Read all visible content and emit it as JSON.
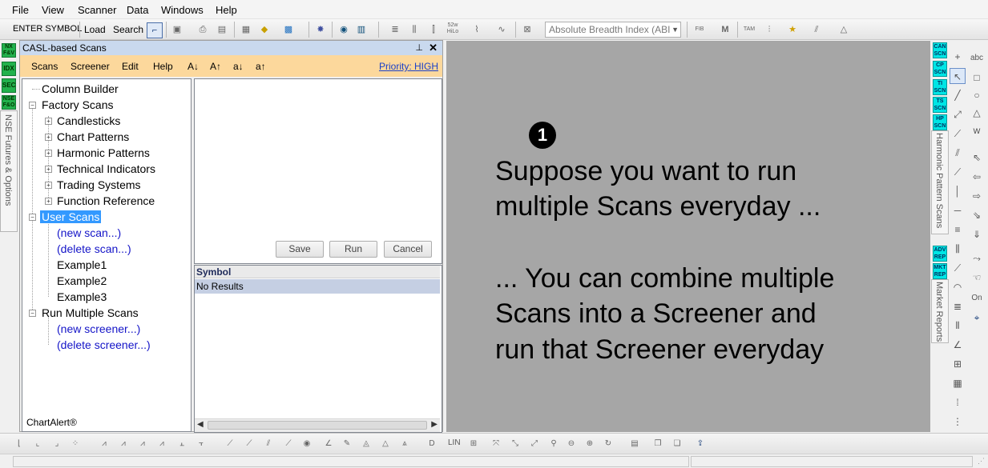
{
  "menu": [
    "File",
    "View",
    "Scanner",
    "Data",
    "Windows",
    "Help"
  ],
  "toolbar": {
    "enter_symbol": "ENTER SYMBOL",
    "load": "Load",
    "search": "Search",
    "icon_52w": "52w HiLo",
    "breadth_select_value": "Absolute Breadth Index (ABI"
  },
  "left_strip": {
    "buttons": [
      "NX F&V",
      "IDX",
      "SEC",
      "NSE F&O"
    ],
    "tab_label": "NSE Futures & Options"
  },
  "panel": {
    "title": "CASL-based Scans",
    "menu": [
      "Scans",
      "Screener",
      "Edit",
      "Help"
    ],
    "sort_buttons": [
      "A↓",
      "A↑",
      "a↓",
      "a↑"
    ],
    "priority": "Priority: HIGH"
  },
  "tree": {
    "column_builder": "Column Builder",
    "factory_scans": "Factory Scans",
    "factory_children": [
      "Candlesticks",
      "Chart Patterns",
      "Harmonic Patterns",
      "Technical Indicators",
      "Trading Systems",
      "Function Reference"
    ],
    "user_scans": "User Scans",
    "user_children": [
      "(new scan...)",
      "(delete scan...)",
      "Example1",
      "Example2",
      "Example3"
    ],
    "run_multiple": "Run Multiple Scans",
    "run_children": [
      "(new screener...)",
      "(delete screener...)"
    ]
  },
  "brand": "ChartAlert®",
  "editor_buttons": {
    "save": "Save",
    "run": "Run",
    "cancel": "Cancel"
  },
  "results": {
    "header": "Symbol",
    "row": "No Results"
  },
  "chart_text": {
    "bullet": "1",
    "lines": [
      "Suppose you want to run",
      "multiple Scans everyday ...",
      "... You can combine multiple",
      "Scans into a Screener and",
      "run that Screener everyday"
    ]
  },
  "right_tabs": {
    "scan_buttons": [
      "CAN SCN",
      "CP SCN",
      "TI SCN",
      "TS SCN",
      "HP SCN"
    ],
    "scan_tab_label": "Harmonic Pattern Scans",
    "report_buttons": [
      "ADV REP",
      "MKT REP"
    ],
    "report_tab_label": "Market Reports"
  },
  "draw_tools": {
    "on_label": "On",
    "abc_label": "abc"
  },
  "bottombar": {
    "lin_label": "LIN"
  },
  "colors": {
    "panel_title_bg": "#c9d9ee",
    "panel_menu_bg": "#fcd89c",
    "chart_bg": "#a6a6a6",
    "selection": "#3399ff",
    "link_blue": "#1414c8",
    "strip_green": "#22b14c",
    "strip_cyan": "#00e5e5"
  }
}
